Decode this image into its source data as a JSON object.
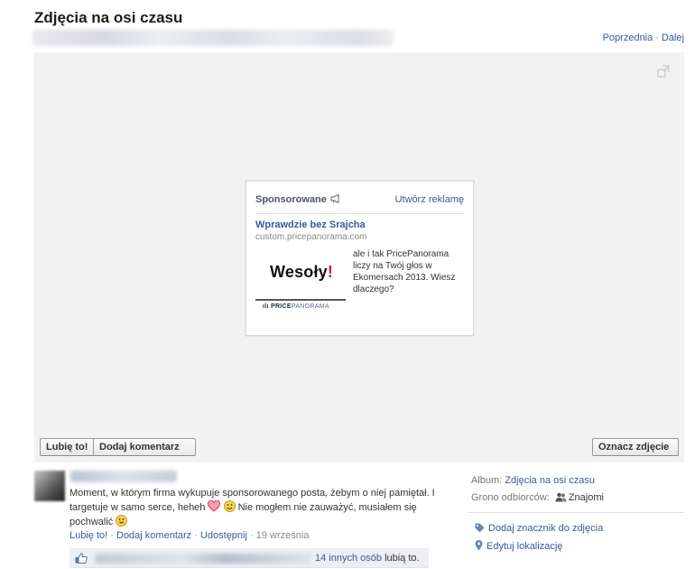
{
  "header": {
    "title": "Zdjęcia na osi czasu",
    "prev_label": "Poprzednia",
    "separator": "·",
    "next_label": "Dalej"
  },
  "ad": {
    "sponsored_label": "Sponsorowane",
    "create_ad_label": "Utwórz reklamę",
    "title": "Wprawdzie bez Srajcha",
    "domain": "custom.pricepanorama.com",
    "image_word": "Wesoły",
    "image_exclamation": "!",
    "image_logo_bold": "PRICE",
    "image_logo_light": "PANORAMA",
    "body": "ale i tak PricePanorama liczy na Twój głos w Ekomersach 2013. Wiesz dlaczego?"
  },
  "photo_buttons": {
    "like": "Lubię to!",
    "comment": "Dodaj komentarz",
    "tag": "Oznacz zdjęcie"
  },
  "post": {
    "caption_part1": "Moment, w którym firma wykupuje sponsorowanego posta, żebym o niej pamiętał. I targetuje w samo serce, heheh",
    "caption_part2": "Nie mogłem nie zauważyć, musiałem się pochwalić",
    "action_like": "Lubię to!",
    "action_comment": "Dodaj komentarz",
    "action_share": "Udostępnij",
    "separator": "·",
    "date": "19 września",
    "likes_others": "14 innych osób",
    "likes_suffix": "lubią to."
  },
  "sidebar": {
    "album_label": "Album:",
    "album_value": "Zdjęcia na osi czasu",
    "audience_label": "Grono odbiorców:",
    "audience_value": "Znajomi",
    "tag_action": "Dodaj znacznik do zdjęcia",
    "location_action": "Edytuj lokalizację"
  },
  "colors": {
    "link": "#3b5998",
    "stage_bg": "#f2f2f2",
    "likes_bg": "#edeff4",
    "heart": "#e0405a",
    "smiley": "#f2c21b"
  }
}
